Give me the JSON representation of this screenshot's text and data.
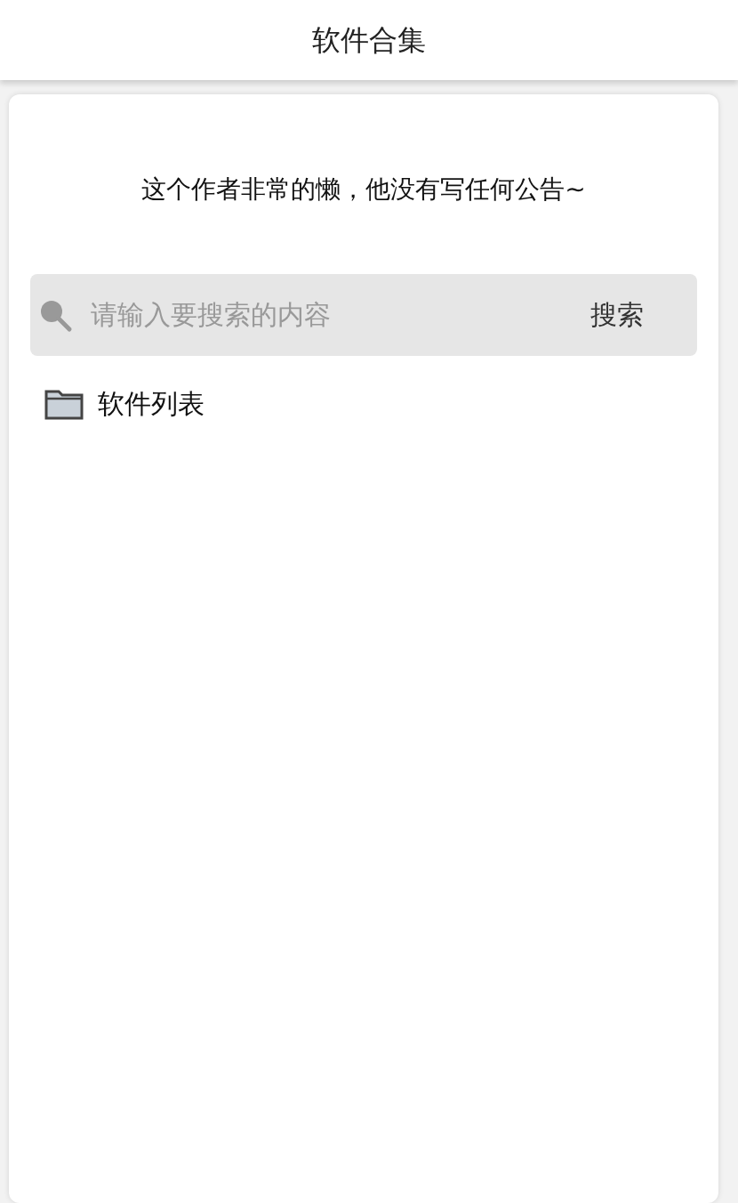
{
  "header": {
    "title": "软件合集"
  },
  "notice": "这个作者非常的懒，他没有写任何公告~",
  "search": {
    "placeholder": "请输入要搜索的内容",
    "button": "搜索"
  },
  "items": [
    {
      "label": "软件列表",
      "kind": "folder"
    }
  ]
}
